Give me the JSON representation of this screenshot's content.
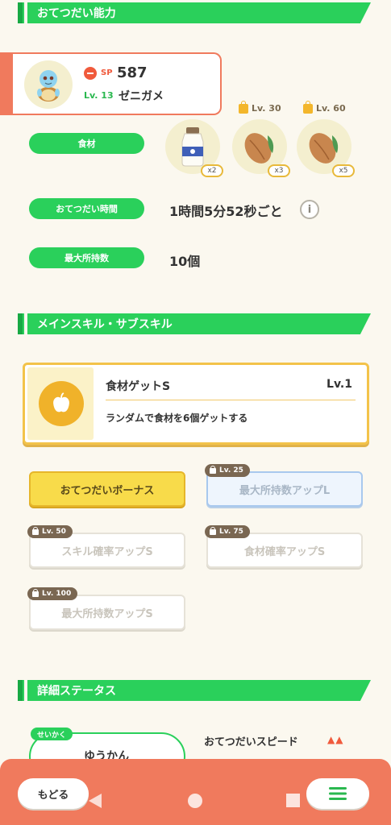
{
  "sections": {
    "helper_ability": "おてつだい能力",
    "skills": "メインスキル・サブスキル",
    "detail_status": "詳細ステータス"
  },
  "pokemon": {
    "sp_label": "SP",
    "sp_value": "587",
    "level": "Lv. 13",
    "name": "ゼニガメ"
  },
  "ability": {
    "ingredients_label": "食材",
    "ingredients": [
      {
        "icon": "milk-bottle-icon",
        "count": "x2",
        "unlock": ""
      },
      {
        "icon": "cacao-bean-icon",
        "count": "x3",
        "unlock": "Lv. 30"
      },
      {
        "icon": "cacao-bean-icon",
        "count": "x5",
        "unlock": "Lv. 60"
      }
    ],
    "help_time_label": "おてつだい時間",
    "help_time_value": "1時間5分52秒ごと",
    "info_glyph": "i",
    "max_carry_label": "最大所持数",
    "max_carry_value": "10個"
  },
  "main_skill": {
    "icon": "apple-icon",
    "name": "食材ゲットS",
    "level": "Lv.1",
    "description": "ランダムで食材を6個ゲットする"
  },
  "sub_skills": [
    {
      "label": "おてつだいボーナス",
      "unlock": "",
      "state": "gold"
    },
    {
      "label": "最大所持数アップL",
      "unlock": "Lv. 25",
      "state": "blue"
    },
    {
      "label": "スキル確率アップS",
      "unlock": "Lv. 50",
      "state": "locked"
    },
    {
      "label": "食材確率アップS",
      "unlock": "Lv. 75",
      "state": "locked"
    },
    {
      "label": "最大所持数アップS",
      "unlock": "Lv. 100",
      "state": "locked"
    }
  ],
  "status": {
    "nature_tag": "せいかく",
    "nature_value": "ゆうかん",
    "speed_label": "おてつだいスピード",
    "speed_arrows": "▲▲"
  },
  "bottom": {
    "back_label": "もどる"
  },
  "colors": {
    "accent_green": "#2ad05b",
    "accent_orange": "#f07a5d",
    "gold": "#f3c34a"
  }
}
